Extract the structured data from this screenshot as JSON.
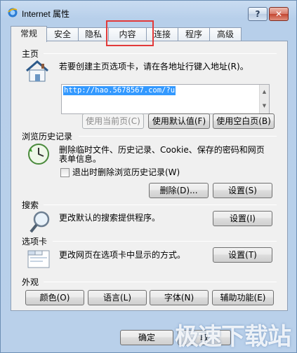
{
  "window": {
    "title": "Internet 属性",
    "help": "?",
    "close": "✕"
  },
  "tabs": [
    {
      "label": "常规",
      "active": true
    },
    {
      "label": "安全"
    },
    {
      "label": "隐私"
    },
    {
      "label": "内容"
    },
    {
      "label": "连接"
    },
    {
      "label": "程序"
    },
    {
      "label": "高级"
    }
  ],
  "homepage": {
    "title": "主页",
    "description": "若要创建主页选项卡，请在各地址行键入地址(R)。",
    "url": "http://hao.5678567.com/?u",
    "buttons": {
      "use_current": "使用当前页(C)",
      "use_default": "使用默认值(F)",
      "use_blank": "使用空白页(B)"
    }
  },
  "history": {
    "title": "浏览历史记录",
    "description": [
      "删除临时文件、历史记录、Cookie、保存的密码和网页",
      "表单信息。"
    ],
    "checkbox_label": "退出时删除浏览历史记录(W)",
    "buttons": {
      "delete": "删除(D)...",
      "settings": "设置(S)"
    }
  },
  "search": {
    "title": "搜索",
    "description": "更改默认的搜索提供程序。",
    "buttons": {
      "settings": "设置(I)"
    }
  },
  "tabs_section": {
    "title": "选项卡",
    "description": "更改网页在选项卡中显示的方式。",
    "buttons": {
      "settings": "设置(T)"
    }
  },
  "appearance": {
    "title": "外观",
    "buttons": {
      "colors": "颜色(O)",
      "languages": "语言(L)",
      "fonts": "字体(N)",
      "accessibility": "辅助功能(E)"
    }
  },
  "footer": {
    "ok": "确定",
    "cancel": "取"
  },
  "watermark": "极速下载站",
  "colors": {
    "highlight": "#e23a3a",
    "url_selection": "#3399ff"
  }
}
